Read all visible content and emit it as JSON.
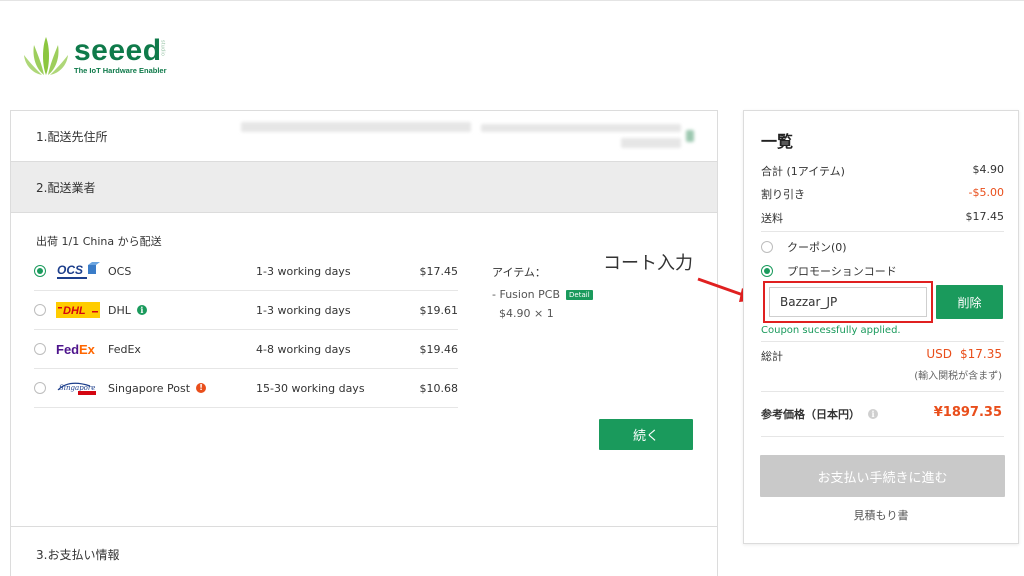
{
  "logo": {
    "brand": "seeed",
    "superscript": "studio",
    "tagline": "The IoT Hardware Enabler"
  },
  "sections": {
    "address_title": "1.配送先住所",
    "carrier_title": "2.配送業者",
    "payment_title": "3.お支払い情報"
  },
  "shipment": {
    "title": "出荷 1/1  China から配送",
    "carriers": [
      {
        "name": "OCS",
        "days": "1-3 working days",
        "price": "$17.45",
        "selected": true
      },
      {
        "name": "DHL",
        "days": "1-3 working days",
        "price": "$19.61",
        "selected": false
      },
      {
        "name": "FedEx",
        "days": "4-8 working days",
        "price": "$19.46",
        "selected": false
      },
      {
        "name": "Singapore Post",
        "days": "15-30 working days",
        "price": "$10.68",
        "selected": false
      }
    ],
    "logo_texts": {
      "ocs": "OCS",
      "dhl": "DHL",
      "fedex_fed": "Fed",
      "fedex_ex": "Ex",
      "singpost": "Singapore"
    }
  },
  "items": {
    "label": "アイテム：",
    "product": "- Fusion PCB",
    "detail_badge": "Detail",
    "price_line": "$4.90 × 1"
  },
  "continue_label": "続く",
  "annotation": {
    "text": "コート入力"
  },
  "summary": {
    "title": "一覧",
    "subtotal_label": "合計 (1アイテム)",
    "subtotal_value": "$4.90",
    "discount_label": "割り引き",
    "discount_value": "-$5.00",
    "shipping_label": "送料",
    "shipping_value": "$17.45",
    "coupon_option": "クーポン(0)",
    "promo_option": "プロモーションコード",
    "promo_code": "Bazzar_JP",
    "delete_label": "削除",
    "coupon_message": "Coupon sucessfully applied.",
    "total_label": "総計",
    "total_currency": "USD",
    "total_value": "$17.35",
    "tax_note": "(輸入関税が含まず)",
    "reference_label": "参考価格（日本円）",
    "reference_value": "¥1897.35",
    "checkout_label": "お支払い手続きに進む",
    "quote_label": "見積もり書"
  },
  "colors": {
    "brand_green": "#1a9a5c",
    "accent_red": "#e94e1b",
    "disabled_gray": "#c9c9c9",
    "highlight_red": "#e02020"
  }
}
